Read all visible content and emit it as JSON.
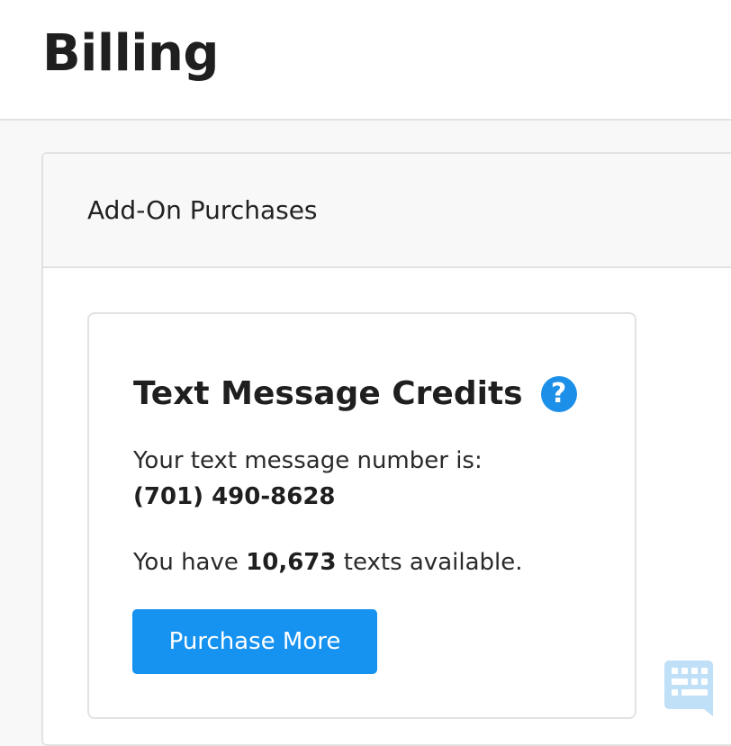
{
  "header": {
    "title": "Billing"
  },
  "panel": {
    "title": "Add-On Purchases"
  },
  "card": {
    "title": "Text Message Credits",
    "help_icon": "question-mark-icon",
    "help_glyph": "?",
    "number_label": "Your text message number is:",
    "number_value": "(701) 490-8628",
    "texts_prefix": "You have",
    "texts_count": "10,673",
    "texts_suffix": "texts available.",
    "purchase_label": "Purchase More"
  },
  "chat_widget": {
    "icon": "chat-bubble-icon"
  },
  "colors": {
    "accent": "#1692f0",
    "help_icon": "#1c8fe8",
    "chat_widget": "#bfe0f7"
  }
}
